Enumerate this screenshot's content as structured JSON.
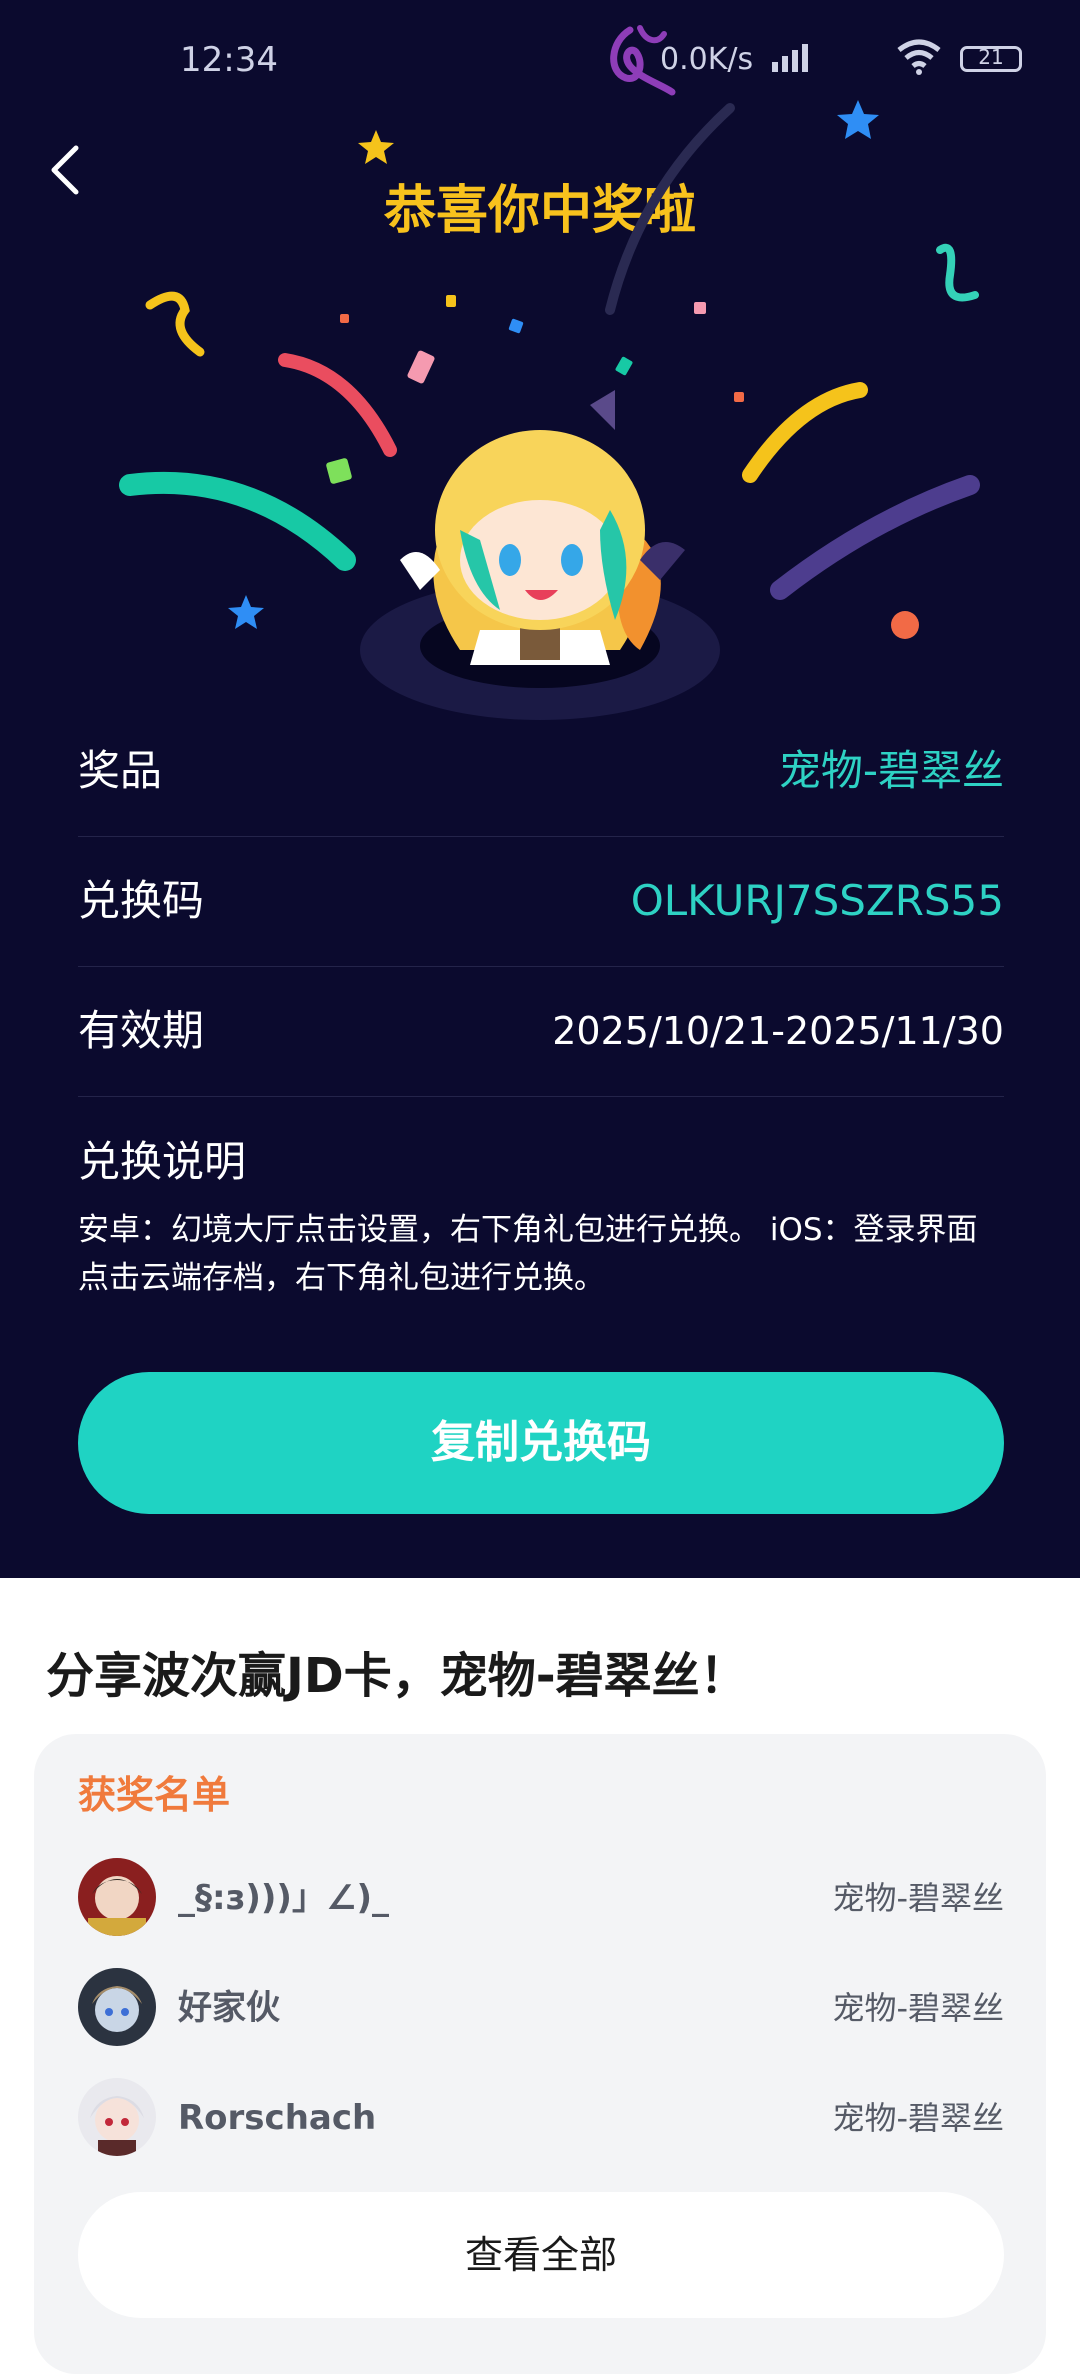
{
  "status_bar": {
    "time": "12:34",
    "net_speed": "0.0K/s",
    "battery": "21"
  },
  "header": {
    "title": "恭喜你中奖啦"
  },
  "prize_info": {
    "prize_label": "奖品",
    "prize_value": "宠物-碧翠丝",
    "code_label": "兑换码",
    "code_value": "OLKURJ7SSZRS55",
    "valid_label": "有效期",
    "valid_value": "2025/10/21-2025/11/30"
  },
  "instructions": {
    "title": "兑换说明",
    "text": "安卓：幻境大厅点击设置，右下角礼包进行兑换。 iOS：登录界面点击云端存档，右下角礼包进行兑换。"
  },
  "actions": {
    "copy_label": "复制兑换码"
  },
  "share": {
    "title": "分享波次赢JD卡，宠物-碧翠丝！"
  },
  "winners": {
    "title": "获奖名单",
    "list": [
      {
        "name": "_§:з)))」∠)_",
        "prize": "宠物-碧翠丝"
      },
      {
        "name": "好家伙",
        "prize": "宠物-碧翠丝"
      },
      {
        "name": "Rorschach",
        "prize": "宠物-碧翠丝"
      }
    ],
    "view_all_label": "查看全部"
  },
  "colors": {
    "background": "#0b0a2e",
    "accent_teal": "#1fd3c3",
    "title_yellow": "#f8c21d",
    "winners_orange": "#f07a3c"
  }
}
